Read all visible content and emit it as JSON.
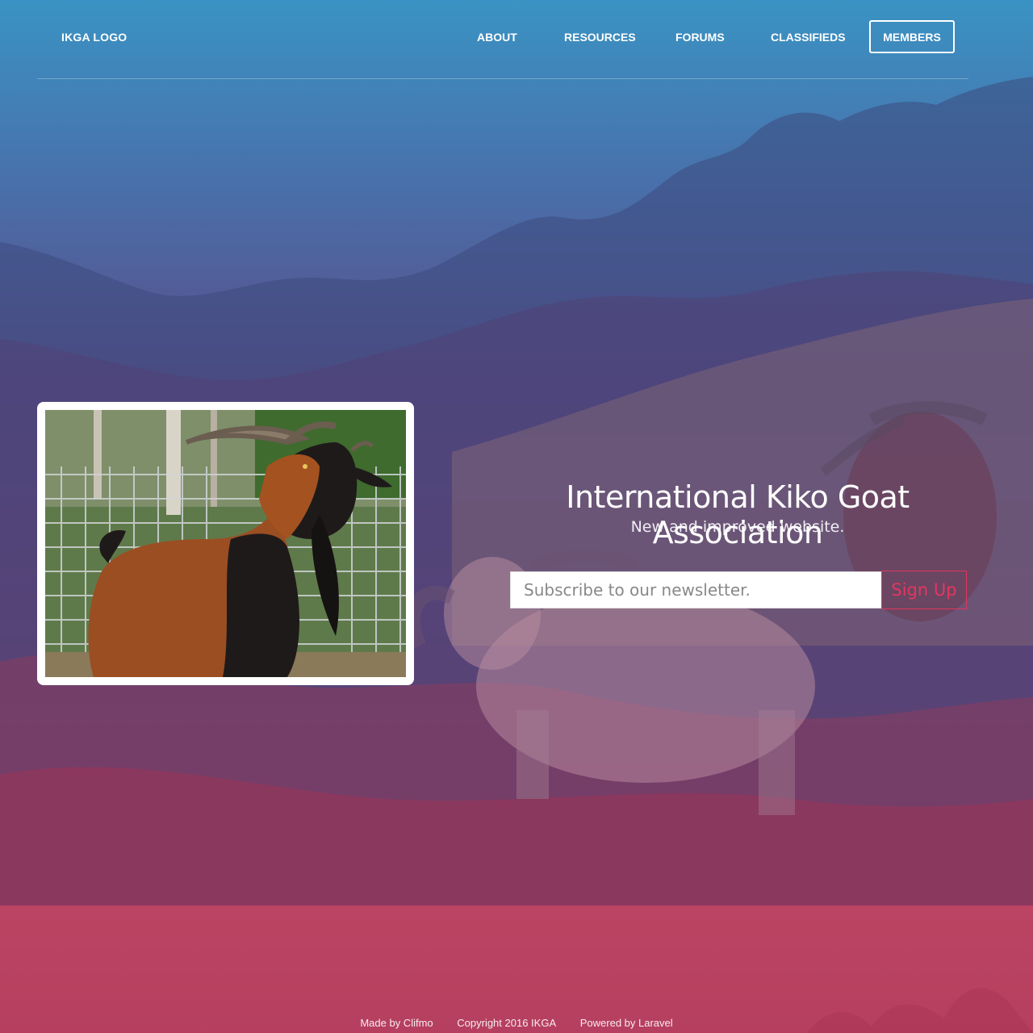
{
  "nav": {
    "logo": "IKGA LOGO",
    "links": [
      "ABOUT",
      "RESOURCES",
      "FORUMS",
      "CLASSIFIEDS"
    ],
    "members": "MEMBERS"
  },
  "hero": {
    "title": "International Kiko Goat Association",
    "subtitle": "New and improved website.",
    "newsletter_placeholder": "Subscribe to our newsletter.",
    "signup_label": "Sign Up"
  },
  "footer": {
    "made_by": "Made by Clifmo",
    "copyright": "Copyright 2016 IKGA",
    "powered_by": "Powered by Laravel"
  },
  "colors": {
    "accent": "#e23660",
    "gradient_top": "#3a93c4",
    "gradient_bottom": "#ad3a5c"
  }
}
